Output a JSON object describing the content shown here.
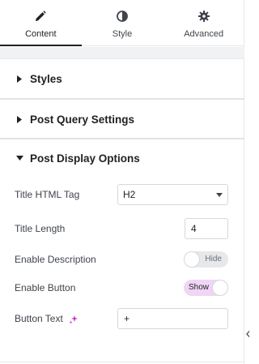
{
  "tabs": [
    {
      "label": "Content",
      "icon": "pencil-icon",
      "active": true
    },
    {
      "label": "Style",
      "icon": "contrast-icon",
      "active": false
    },
    {
      "label": "Advanced",
      "icon": "gear-icon",
      "active": false
    }
  ],
  "sections": [
    {
      "title": "Styles",
      "expanded": false
    },
    {
      "title": "Post Query Settings",
      "expanded": false
    },
    {
      "title": "Post Display Options",
      "expanded": true
    }
  ],
  "controls": {
    "title_html_tag": {
      "label": "Title HTML Tag",
      "value": "H2"
    },
    "title_length": {
      "label": "Title Length",
      "value": "4"
    },
    "enable_description": {
      "label": "Enable Description",
      "state": "Hide"
    },
    "enable_button": {
      "label": "Enable Button",
      "state": "Show"
    },
    "button_text": {
      "label": "Button Text",
      "value": "+"
    }
  },
  "colors": {
    "accent_pink": "#f0d5f5",
    "ai_icon": "#c43ec9",
    "text_dark": "#1f2124"
  }
}
